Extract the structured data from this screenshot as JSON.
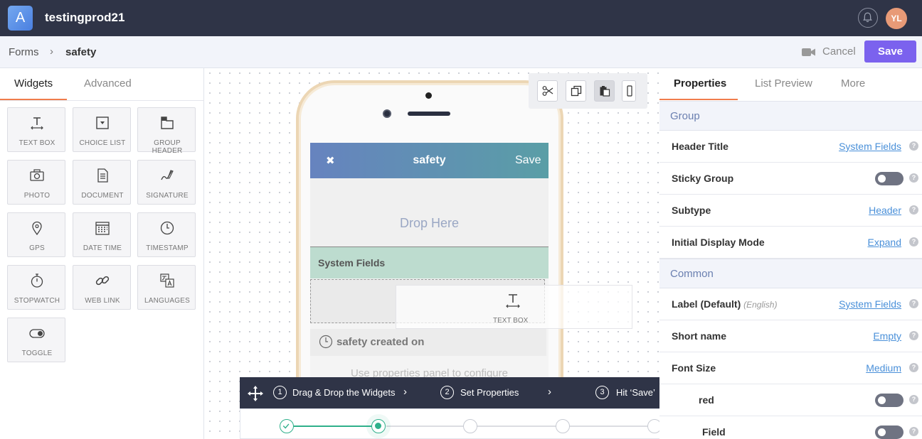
{
  "app": {
    "logo_letter": "A",
    "title": "testingprod21",
    "user_initials": "YL"
  },
  "breadcrumb": {
    "forms": "Forms",
    "separator": "›",
    "current": "safety",
    "cancel_label": "Cancel",
    "save_label": "Save"
  },
  "left_panel": {
    "tabs": [
      {
        "label": "Widgets",
        "active": true
      },
      {
        "label": "Advanced",
        "active": false
      }
    ],
    "widgets": [
      {
        "label": "TEXT BOX",
        "icon": "text-box-icon"
      },
      {
        "label": "CHOICE LIST",
        "icon": "choice-list-icon"
      },
      {
        "label": "GROUP HEADER",
        "icon": "group-header-icon"
      },
      {
        "label": "PHOTO",
        "icon": "camera-icon"
      },
      {
        "label": "DOCUMENT",
        "icon": "document-icon"
      },
      {
        "label": "SIGNATURE",
        "icon": "signature-icon"
      },
      {
        "label": "GPS",
        "icon": "location-pin-icon"
      },
      {
        "label": "DATE TIME",
        "icon": "calendar-icon"
      },
      {
        "label": "TIMESTAMP",
        "icon": "clock-icon"
      },
      {
        "label": "STOPWATCH",
        "icon": "stopwatch-icon"
      },
      {
        "label": "WEB LINK",
        "icon": "link-icon"
      },
      {
        "label": "LANGUAGES",
        "icon": "translate-icon"
      },
      {
        "label": "TOGGLE",
        "icon": "toggle-icon"
      }
    ]
  },
  "canvas": {
    "form_header": {
      "close": "✖",
      "title": "safety",
      "save": "Save"
    },
    "drop_here": "Drop Here",
    "system_fields": "System Fields",
    "created_on": "safety created on",
    "hint": "Use properties panel to configure",
    "drag_ghost_label": "TEXT BOX"
  },
  "guide": {
    "steps": [
      {
        "num": "1",
        "label": "Drag & Drop the Widgets"
      },
      {
        "num": "2",
        "label": "Set Properties"
      },
      {
        "num": "3",
        "label": "Hit ‘Save’"
      }
    ],
    "chevron": "›",
    "progress_total": 5,
    "progress_current": 2
  },
  "right_panel": {
    "tabs": [
      {
        "label": "Properties",
        "active": true
      },
      {
        "label": "List Preview",
        "active": false
      },
      {
        "label": "More",
        "active": false
      }
    ],
    "sections": [
      {
        "title": "Group",
        "rows": [
          {
            "label": "Header Title",
            "type": "link",
            "value": "System Fields"
          },
          {
            "label": "Sticky Group",
            "type": "toggle",
            "value": "off"
          },
          {
            "label": "Subtype",
            "type": "link",
            "value": "Header"
          },
          {
            "label": "Initial Display Mode",
            "type": "link",
            "value": "Expand"
          }
        ]
      },
      {
        "title": "Common",
        "rows": [
          {
            "label": "Label (Default)",
            "sub": "(English)",
            "type": "link",
            "value": "System Fields"
          },
          {
            "label": "Short name",
            "type": "link",
            "value": "Empty"
          },
          {
            "label": "Font Size",
            "type": "link",
            "value": "Medium"
          },
          {
            "label": "red",
            "type": "toggle",
            "value": "off"
          },
          {
            "label": "Field",
            "type": "toggle",
            "value": "off"
          }
        ]
      }
    ],
    "help": "?"
  },
  "colors": {
    "topbar": "#2f3447",
    "accent": "#7b62ee",
    "tab_underline": "#f07c4c",
    "link": "#4a90d9",
    "progress": "#2fb08b"
  }
}
